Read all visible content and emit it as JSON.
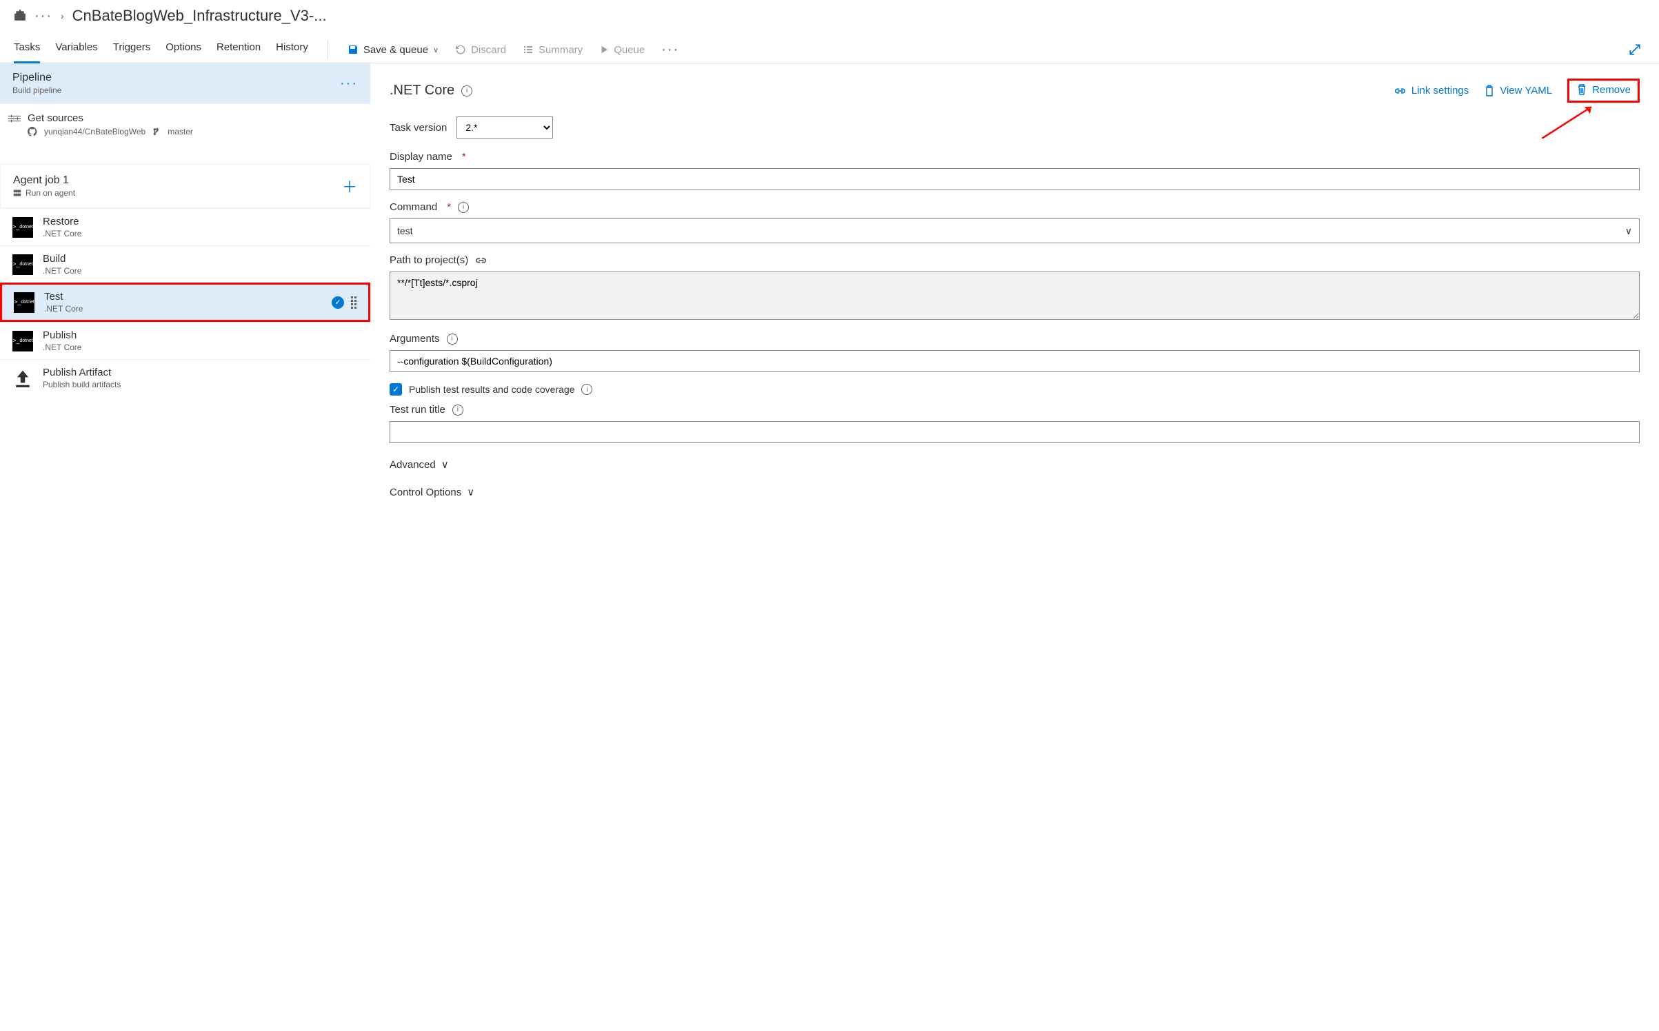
{
  "breadcrumb": {
    "project_title": "CnBateBlogWeb_Infrastructure_V3-..."
  },
  "tabs": [
    "Tasks",
    "Variables",
    "Triggers",
    "Options",
    "Retention",
    "History"
  ],
  "active_tab_index": 0,
  "toolbar": {
    "save_queue": "Save & queue",
    "discard": "Discard",
    "summary": "Summary",
    "queue": "Queue"
  },
  "left": {
    "pipeline_title": "Pipeline",
    "pipeline_subtitle": "Build pipeline",
    "get_sources_title": "Get sources",
    "repo": "yunqian44/CnBateBlogWeb",
    "branch": "master",
    "agent_job_title": "Agent job 1",
    "agent_job_sub": "Run on agent",
    "tasks": [
      {
        "name": "Restore",
        "sub": ".NET Core",
        "icon": "dotnet"
      },
      {
        "name": "Build",
        "sub": ".NET Core",
        "icon": "dotnet"
      },
      {
        "name": "Test",
        "sub": ".NET Core",
        "icon": "dotnet",
        "selected": true
      },
      {
        "name": "Publish",
        "sub": ".NET Core",
        "icon": "dotnet"
      },
      {
        "name": "Publish Artifact",
        "sub": "Publish build artifacts",
        "icon": "upload"
      }
    ]
  },
  "right": {
    "panel_title": ".NET Core",
    "link_settings": "Link settings",
    "view_yaml": "View YAML",
    "remove": "Remove",
    "task_version_label": "Task version",
    "task_version_value": "2.*",
    "display_name_label": "Display name",
    "display_name_value": "Test",
    "command_label": "Command",
    "command_value": "test",
    "path_label": "Path to project(s)",
    "path_value": "**/*[Tt]ests/*.csproj",
    "arguments_label": "Arguments",
    "arguments_value": "--configuration $(BuildConfiguration)",
    "publish_results_label": "Publish test results and code coverage",
    "publish_results_checked": true,
    "test_run_title_label": "Test run title",
    "test_run_title_value": "",
    "advanced_label": "Advanced",
    "control_options_label": "Control Options"
  }
}
